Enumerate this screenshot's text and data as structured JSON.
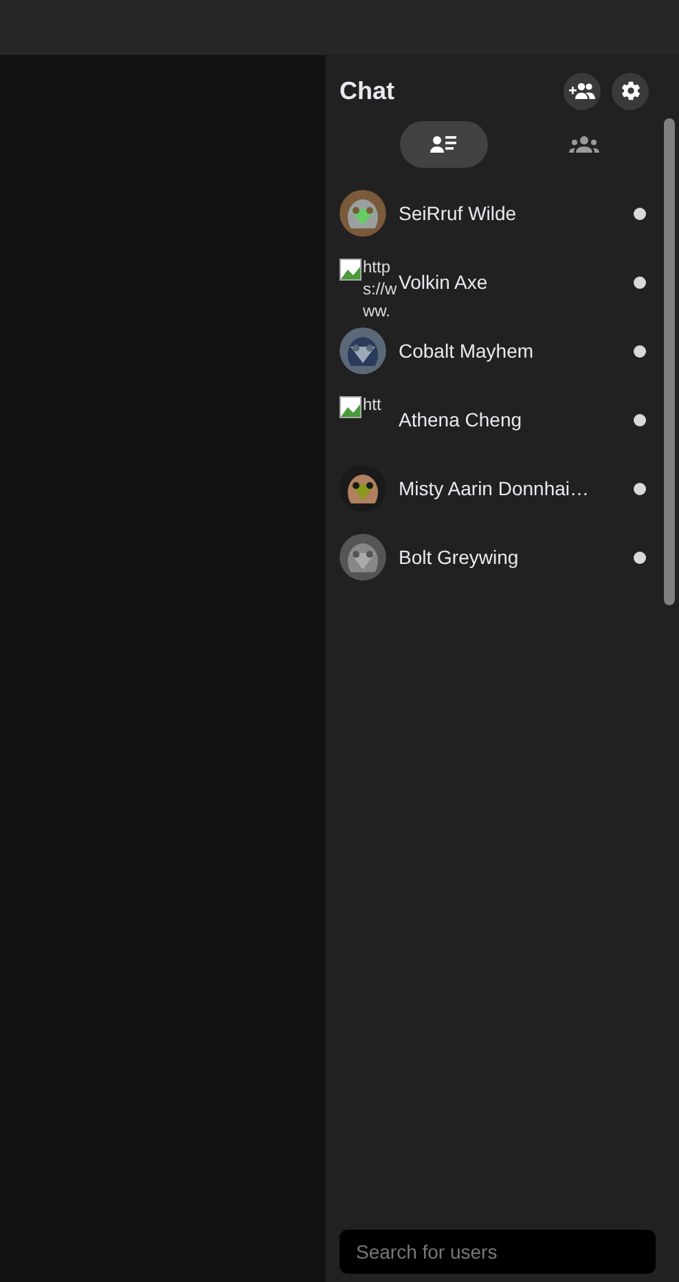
{
  "chat": {
    "title": "Chat",
    "tabs": [
      {
        "kind": "contacts",
        "selected": true
      },
      {
        "kind": "groups",
        "selected": false
      }
    ],
    "users": [
      {
        "name": "SeiRruf Wilde",
        "online": true
      },
      {
        "name": "Volkin Axe",
        "avatar": {
          "kind": "broken",
          "alt": "https://www."
        },
        "online": true
      },
      {
        "name": "Cobalt Mayhem",
        "online": true
      },
      {
        "name": "Athena Cheng",
        "avatar": {
          "kind": "broken",
          "alt": "htt"
        },
        "online": true
      },
      {
        "name": "Misty Aarin Donnhai…",
        "online": true
      },
      {
        "name": "Bolt Greywing",
        "online": true
      }
    ],
    "search": {
      "placeholder": "Search for users"
    }
  }
}
